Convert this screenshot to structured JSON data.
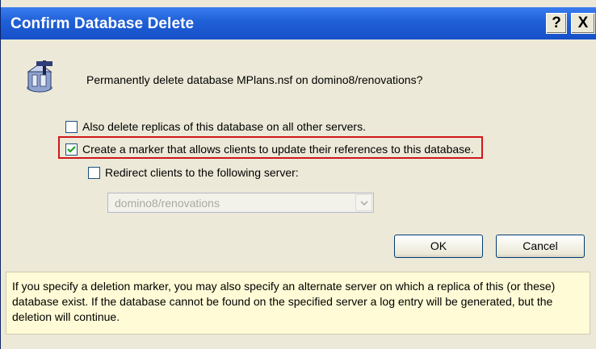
{
  "window": {
    "title": "Confirm Database Delete",
    "help_label": "?",
    "close_label": "X"
  },
  "dialog": {
    "question": "Permanently delete database MPlans.nsf on domino8/renovations?",
    "options": [
      {
        "label": "Also delete replicas of this database on all other servers.",
        "checked": false
      },
      {
        "label": "Create a marker that allows clients to update their references to this database.",
        "checked": true
      },
      {
        "label": "Redirect clients to the following server:",
        "checked": false
      }
    ],
    "server_select": {
      "value": "domino8/renovations",
      "enabled": false
    },
    "buttons": {
      "ok": "OK",
      "cancel": "Cancel"
    },
    "info": "If you specify a deletion marker, you may also specify an alternate server on which a replica of this (or these) database exist.  If the database cannot be found on the specified server a log entry will be generated, but the deletion will continue."
  },
  "colors": {
    "titlebar": "#1f5fd6",
    "dialog_bg": "#ece9d8",
    "highlight_border": "#d0161a",
    "info_bg": "#fffbd6",
    "checkmark": "#21a121"
  },
  "icons": [
    "database-delete-icon",
    "checkmark-icon",
    "chevron-down-icon"
  ]
}
